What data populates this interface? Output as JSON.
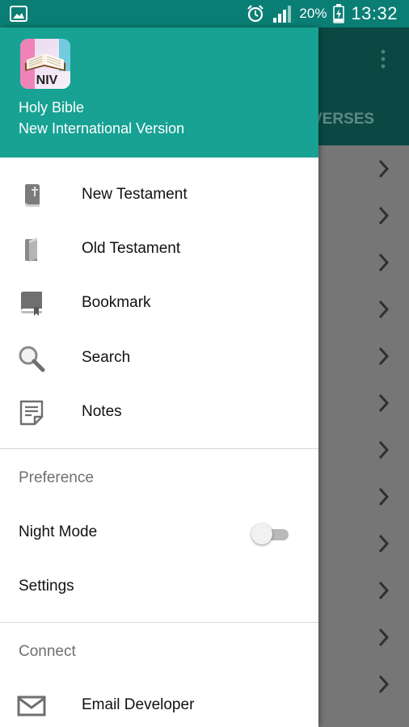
{
  "status_bar": {
    "notification_icon": "image-icon",
    "alarm_icon": "alarm-clock-icon",
    "signal_icon": "cell-signal-icon",
    "battery_percent": "20%",
    "battery_icon": "battery-charging-icon",
    "time": "13:32"
  },
  "background_app": {
    "tab_label": "VERSES",
    "overflow_icon": "overflow-menu-icon",
    "row_icon": "chevron-right-icon",
    "row_count": 12
  },
  "drawer": {
    "header": {
      "logo_text": "NIV",
      "title": "Holy Bible",
      "subtitle": "New International Version"
    },
    "menu": [
      {
        "label": "New Testament",
        "icon": "new-testament-book-icon"
      },
      {
        "label": "Old Testament",
        "icon": "old-testament-book-icon"
      },
      {
        "label": "Bookmark",
        "icon": "bookmark-icon"
      },
      {
        "label": "Search",
        "icon": "search-icon"
      },
      {
        "label": "Notes",
        "icon": "notes-icon"
      }
    ],
    "preference": {
      "header": "Preference",
      "night_mode_label": "Night Mode",
      "night_mode_on": false,
      "settings_label": "Settings"
    },
    "connect": {
      "header": "Connect",
      "email_label": "Email Developer",
      "email_icon": "mail-icon"
    }
  },
  "colors": {
    "status_bar": "#0a7e74",
    "drawer_header": "#17a293",
    "app_toolbar": "#0b4843",
    "scrim_list": "#767676"
  }
}
